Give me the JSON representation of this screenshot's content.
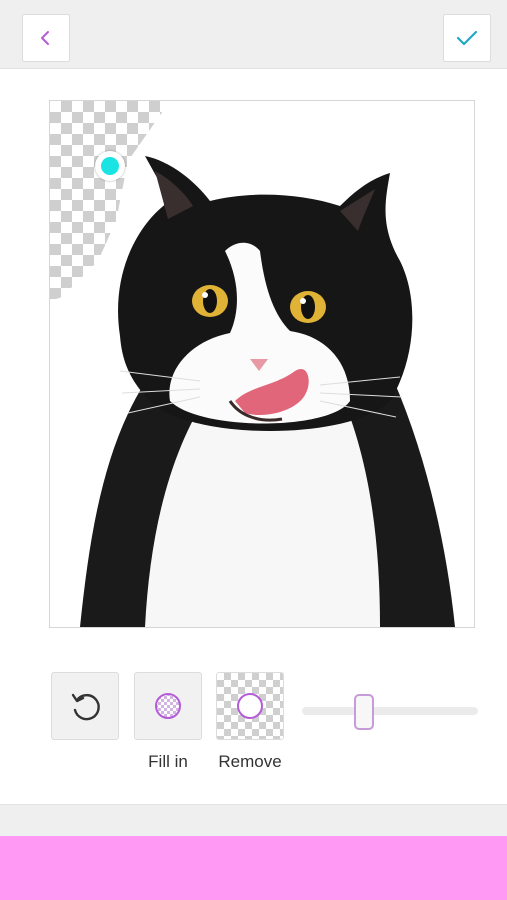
{
  "header": {
    "back_icon": "chevron-left-icon",
    "done_icon": "checkmark-icon",
    "accent_color": "#b45cd6",
    "done_color": "#1fa8c9"
  },
  "canvas": {
    "subject": "black-and-white-cat-photo",
    "brush_cursor_color": "#19e3e3"
  },
  "tools": {
    "undo_icon": "undo-icon",
    "fill_label": "Fill in",
    "fill_icon": "fill-brush-icon",
    "remove_label": "Remove",
    "remove_icon": "remove-brush-icon",
    "brush_size_level": 0.35
  },
  "bottom_bar": {
    "color": "#ff99f4"
  }
}
